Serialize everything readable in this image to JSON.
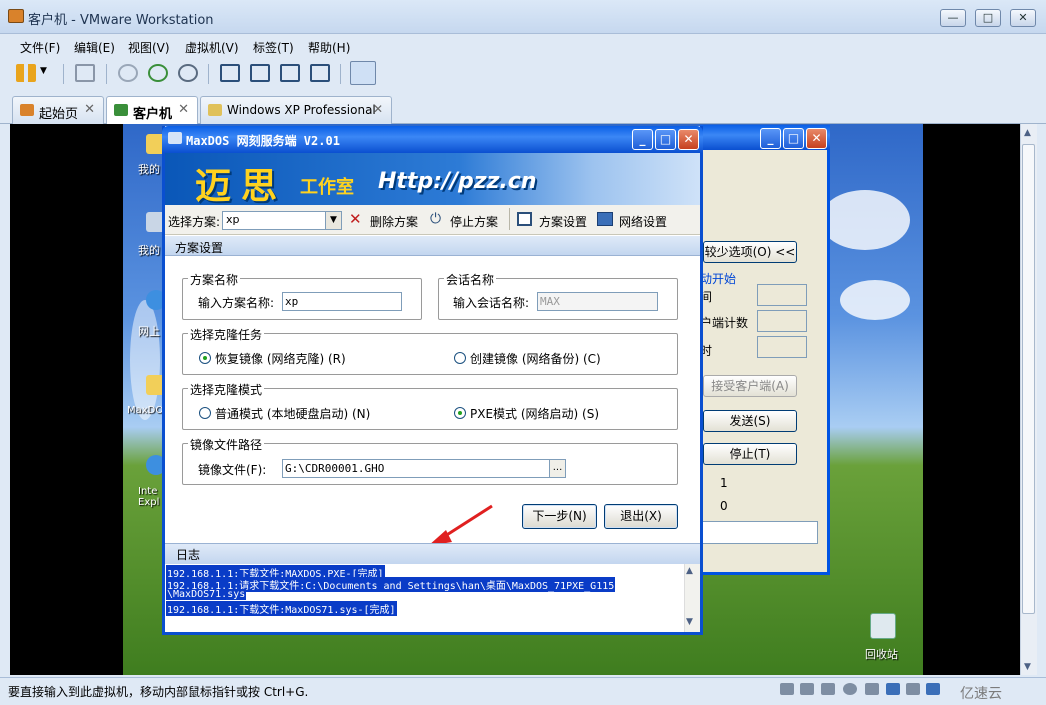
{
  "window": {
    "title": "客户机 - VMware Workstation",
    "min": "—",
    "max": "□",
    "close": "✕"
  },
  "menu": [
    "文件(F)",
    "编辑(E)",
    "视图(V)",
    "虚拟机(V)",
    "标签(T)",
    "帮助(H)"
  ],
  "tabs": [
    {
      "label": "起始页",
      "close": "✕"
    },
    {
      "label": "客户机",
      "close": "✕"
    },
    {
      "label": "Windows XP Professional",
      "close": "✕"
    }
  ],
  "desktop_icons": [
    {
      "label": "我的"
    },
    {
      "label": "我的"
    },
    {
      "label": "网上"
    },
    {
      "label": "MaxDOS"
    },
    {
      "label": "Inte Expl"
    }
  ],
  "recycle": {
    "label": "回收站"
  },
  "back_window": {
    "btn_fewer": "较少选项(O) <<",
    "start_label": "动开始",
    "row1": "间",
    "row2": "户端计数",
    "row3": "时",
    "btn_accept": "接受客户端(A)",
    "btn_send": "发送(S)",
    "btn_stop": "停止(T)",
    "val1": "1",
    "val2": "0"
  },
  "main_window": {
    "title": "MaxDOS 网刻服务端 V2.01",
    "banner": {
      "logo": "迈思",
      "work": "工作室",
      "url": "Http://pzz.cn"
    },
    "toolbar": {
      "scheme_label": "选择方案:",
      "scheme_value": "xp",
      "delete": "删除方案",
      "stop": "停止方案",
      "settings": "方案设置",
      "network": "网络设置"
    },
    "section_title": "方案设置",
    "scheme_group": {
      "title": "方案名称",
      "label": "输入方案名称:",
      "value": "xp"
    },
    "session_group": {
      "title": "会话名称",
      "label": "输入会话名称:",
      "value": "MAX"
    },
    "task_group": {
      "title": "选择克隆任务",
      "opt1": "恢复镜像 (网络克隆) (R)",
      "opt2": "创建镜像 (网络备份) (C)",
      "selected": 1
    },
    "mode_group": {
      "title": "选择克隆模式",
      "opt1": "普通模式 (本地硬盘启动) (N)",
      "opt2": "PXE模式 (网络启动) (S)",
      "selected": 2
    },
    "path_group": {
      "title": "镜像文件路径",
      "label": "镜像文件(F):",
      "value": "G:\\CDR00001.GHO",
      "browse": "..."
    },
    "btn_next": "下一步(N)",
    "btn_exit": "退出(X)",
    "log_title": "日志",
    "log_lines": [
      "192.168.1.1:下载文件:MAXDOS.PXE-[完成]",
      "192.168.1.1:请求下载文件:C:\\Documents and Settings\\han\\桌面\\MaxDOS_71PXE_G115",
      "\\MaxDOS71.sys",
      "192.168.1.1:下载文件:MaxDOS71.sys-[完成]"
    ]
  },
  "status": {
    "text": "要直接输入到此虚拟机，移动内部鼠标指针或按 Ctrl+G.",
    "watermark": "亿速云"
  }
}
